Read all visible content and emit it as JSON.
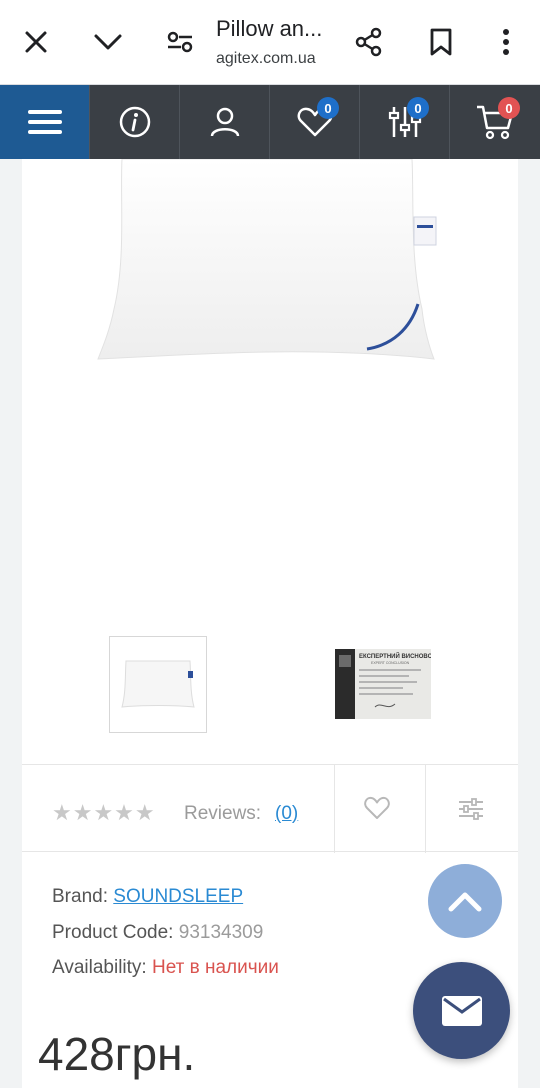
{
  "browser": {
    "title": "Pillow an...",
    "url": "agitex.com.ua"
  },
  "nav": {
    "wishlist_count": "0",
    "compare_count": "0",
    "cart_count": "0",
    "colors": {
      "menu_bg": "#1e5a93",
      "bar_bg": "#3a3f45",
      "badge_blue": "#1e6fc9",
      "badge_red": "#e25353"
    }
  },
  "product": {
    "stars": "★★★★★",
    "reviews_label": "Reviews:",
    "reviews_count": "(0)",
    "brand_label": "Brand:",
    "brand_value": "SOUNDSLEEP",
    "code_label": "Product Code:",
    "code_value": "93134309",
    "availability_label": "Availability:",
    "availability_value": "Нет в наличии",
    "price": "428грн."
  },
  "certificate": {
    "heading": "ЕКСПЕРТНИЙ ВИСНОВОК",
    "subheading": "EXPERT CONCLUSION"
  }
}
